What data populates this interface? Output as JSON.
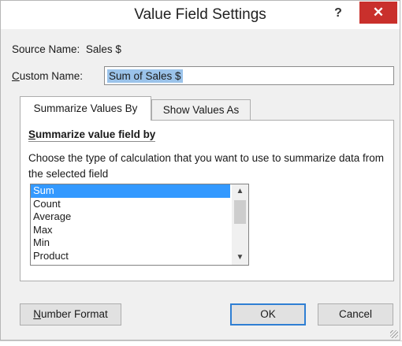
{
  "dialog": {
    "title": "Value Field Settings",
    "help_label": "?",
    "close_label": "✕"
  },
  "source": {
    "label": "Source Name:",
    "value": "Sales $"
  },
  "custom_name": {
    "label_accesskey": "C",
    "label_rest": "ustom Name:",
    "value": "Sum of Sales $"
  },
  "tabs": [
    {
      "label": "Summarize Values By",
      "active": true
    },
    {
      "label": "Show Values As",
      "active": false
    }
  ],
  "panel": {
    "section_title_accesskey": "S",
    "section_title_rest": "ummarize value field by",
    "description": "Choose the type of calculation that you want to use to summarize data from the selected field"
  },
  "calc_list": {
    "items": [
      "Sum",
      "Count",
      "Average",
      "Max",
      "Min",
      "Product"
    ],
    "selected_index": 0
  },
  "buttons": {
    "number_format_accesskey": "N",
    "number_format_rest": "umber Format",
    "ok": "OK",
    "cancel": "Cancel"
  },
  "colors": {
    "close_button": "#c9302c",
    "selection": "#3399ff",
    "text_highlight": "#9bc3ea",
    "default_button_border": "#2f7fd3"
  }
}
